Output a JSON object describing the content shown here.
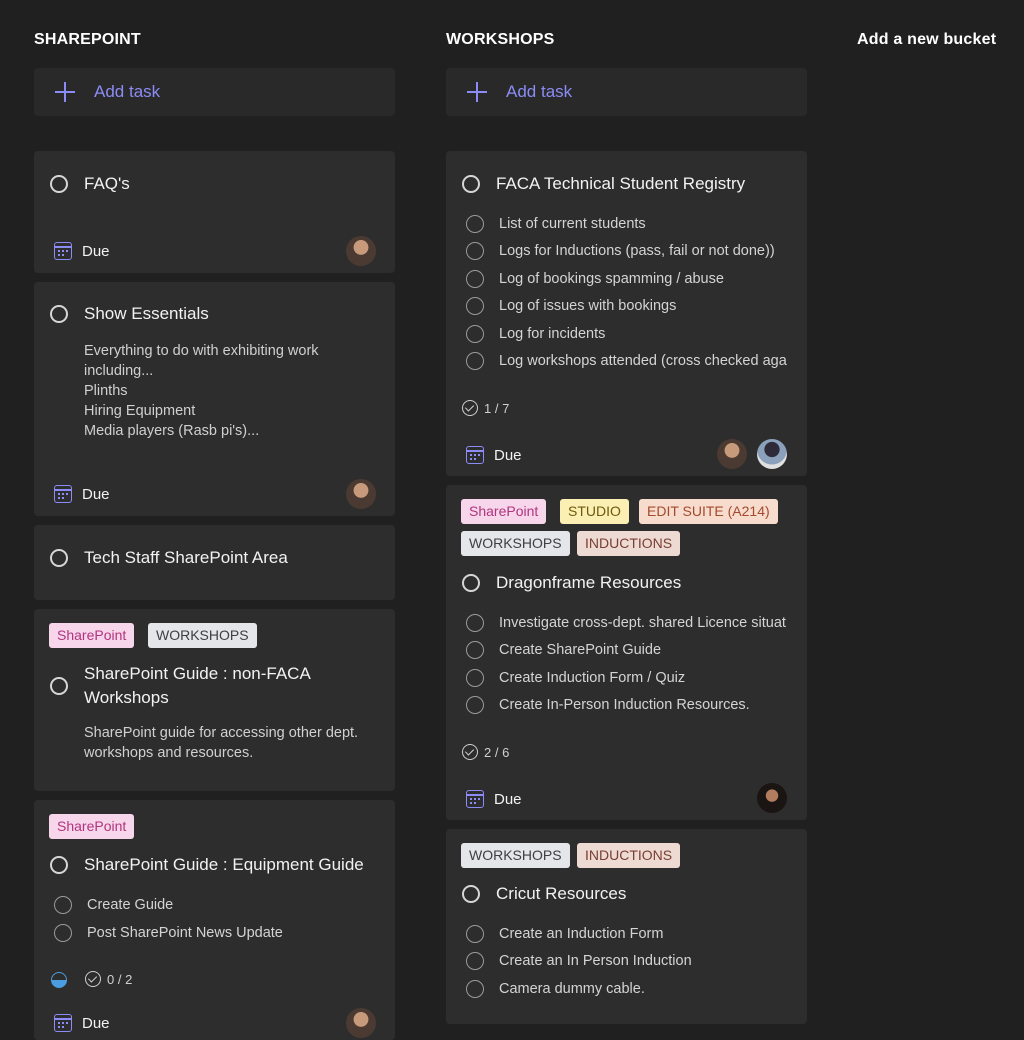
{
  "buckets": [
    {
      "title": "SHAREPOINT",
      "add_task": "Add task"
    },
    {
      "title": "WORKSHOPS",
      "add_task": "Add task"
    }
  ],
  "add_bucket": "Add a new bucket",
  "sharepoint_tasks": [
    {
      "title": "FAQ's",
      "due": "Due"
    },
    {
      "title": "Show Essentials",
      "description": "Everything to do with exhibiting work\nincluding...\nPlinths\nHiring Equipment\nMedia players (Rasb pi's)...",
      "due": "Due"
    },
    {
      "title": "Tech Staff SharePoint Area"
    },
    {
      "tags": [
        "SharePoint",
        "WORKSHOPS"
      ],
      "title": "SharePoint Guide : non-FACA Workshops",
      "description": "SharePoint guide for accessing other dept.\nworkshops and resources."
    },
    {
      "tags": [
        "SharePoint"
      ],
      "title": "SharePoint Guide : Equipment Guide",
      "subtasks": [
        "Create Guide",
        "Post SharePoint News Update"
      ],
      "checklist": "0 / 2",
      "due": "Due"
    }
  ],
  "workshop_tasks": [
    {
      "title": "FACA Technical Student Registry",
      "subtasks": [
        "List of current students",
        "Logs for Inductions (pass, fail or not done))",
        "Log of bookings spamming / abuse",
        "Log of issues with bookings",
        "Log for incidents",
        "Log workshops attended (cross checked aga"
      ],
      "checklist": "1 / 7",
      "due": "Due"
    },
    {
      "tags": [
        "SharePoint",
        "STUDIO",
        "EDIT SUITE (A214)",
        "WORKSHOPS",
        "INDUCTIONS"
      ],
      "title": "Dragonframe Resources",
      "subtasks": [
        "Investigate cross-dept. shared Licence situat",
        "Create SharePoint Guide",
        "Create Induction Form / Quiz",
        "Create In-Person Induction Resources."
      ],
      "checklist": "2 / 6",
      "due": "Due"
    },
    {
      "tags": [
        "WORKSHOPS",
        "INDUCTIONS"
      ],
      "title": "Cricut Resources",
      "subtasks": [
        "Create an Induction Form",
        "Create an In Person Induction",
        "Camera dummy cable."
      ]
    }
  ],
  "colors": {
    "background": "#202020",
    "card": "#2d2d2d",
    "accent": "#8b8cf5"
  }
}
